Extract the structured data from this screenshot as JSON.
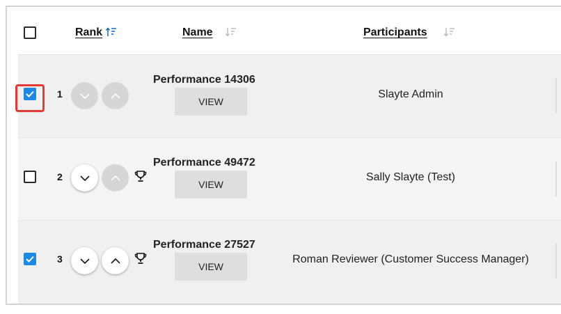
{
  "table": {
    "columns": {
      "rank": "Rank",
      "name": "Name",
      "participants": "Participants"
    },
    "view_label": "VIEW",
    "rows": [
      {
        "rank": "1",
        "title": "Performance 14306",
        "participant": "Slayte Admin",
        "checked": true,
        "move_down_enabled": false,
        "move_up_enabled": false,
        "trophy": false
      },
      {
        "rank": "2",
        "title": "Performance 49472",
        "participant": "Sally Slayte (Test)",
        "checked": false,
        "move_down_enabled": true,
        "move_up_enabled": false,
        "trophy": true
      },
      {
        "rank": "3",
        "title": "Performance 27527",
        "participant": "Roman Reviewer (Customer Success Manager)",
        "checked": true,
        "move_down_enabled": true,
        "move_up_enabled": true,
        "trophy": true
      }
    ]
  },
  "colors": {
    "checkbox_checked": "#1e88e5",
    "focus_ring": "#e53935",
    "sort_active": "#1565c0",
    "sort_inactive": "#bdbdbd"
  },
  "icons": {
    "sort_active": "sort-ascending-icon",
    "sort_inactive": "sort-descending-icon",
    "move_down": "chevron-down-icon",
    "move_up": "chevron-up-icon",
    "trophy": "trophy-icon",
    "check": "checkmark-icon"
  }
}
